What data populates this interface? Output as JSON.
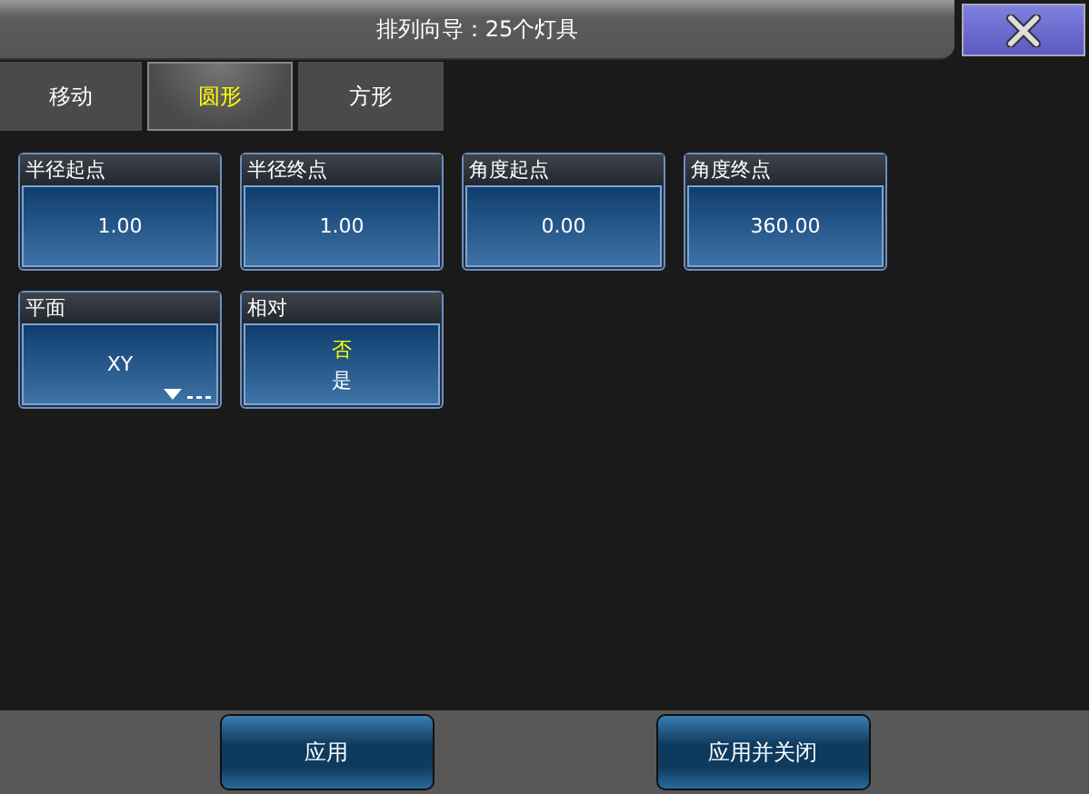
{
  "window": {
    "title": "排列向导：25个灯具"
  },
  "tabs": [
    {
      "label": "移动",
      "selected": false
    },
    {
      "label": "圆形",
      "selected": true
    },
    {
      "label": "方形",
      "selected": false
    }
  ],
  "rows": [
    [
      {
        "kind": "value",
        "label": "半径起点",
        "value": "1.00"
      },
      {
        "kind": "value",
        "label": "半径终点",
        "value": "1.00"
      },
      {
        "kind": "value",
        "label": "角度起点",
        "value": "0.00"
      },
      {
        "kind": "value",
        "label": "角度终点",
        "value": "360.00"
      }
    ],
    [
      {
        "kind": "dropdown",
        "label": "平面",
        "value": "XY"
      },
      {
        "kind": "options",
        "label": "相对",
        "options": [
          {
            "label": "否",
            "selected": true
          },
          {
            "label": "是",
            "selected": false
          }
        ]
      }
    ]
  ],
  "buttons": [
    "应用",
    "应用并关闭"
  ]
}
